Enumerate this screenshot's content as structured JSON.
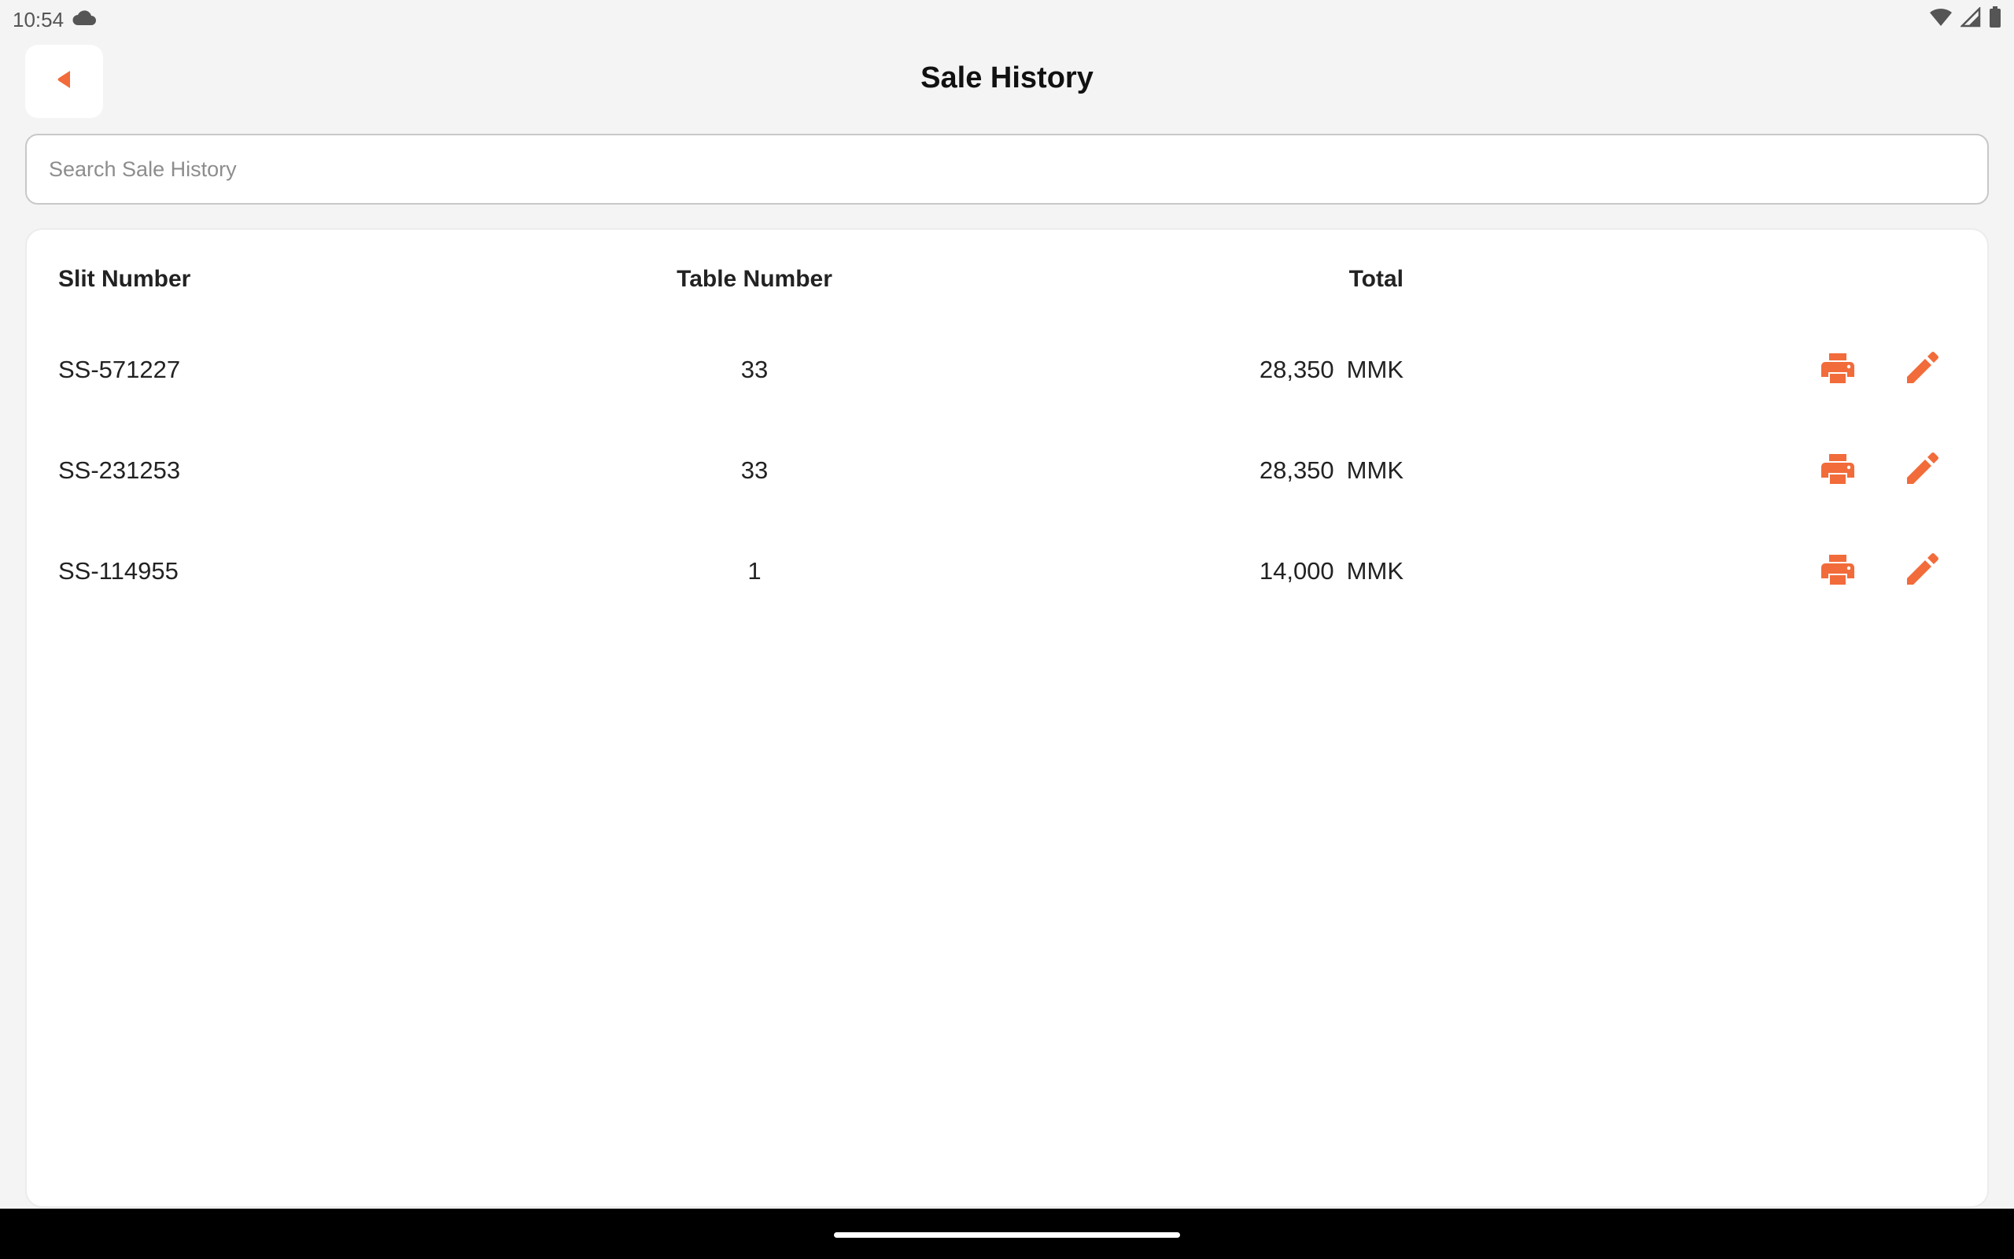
{
  "status_bar": {
    "time": "10:54",
    "icons": [
      "cloud-icon",
      "wifi-icon",
      "signal-icon",
      "battery-icon"
    ]
  },
  "header": {
    "title": "Sale History",
    "back_icon": "back-arrow-icon"
  },
  "search": {
    "placeholder": "Search Sale History",
    "value": ""
  },
  "table": {
    "columns": {
      "slit": "Slit Number",
      "table": "Table Number",
      "total": "Total"
    },
    "rows": [
      {
        "slit": "SS-571227",
        "table": "33",
        "amount": "28,350",
        "currency": "MMK"
      },
      {
        "slit": "SS-231253",
        "table": "33",
        "amount": "28,350",
        "currency": "MMK"
      },
      {
        "slit": "SS-114955",
        "table": "1",
        "amount": "14,000",
        "currency": "MMK"
      }
    ],
    "row_actions": [
      "printer-icon",
      "pencil-icon"
    ]
  },
  "colors": {
    "accent": "#f26b3a",
    "background": "#f4f4f4",
    "card": "#ffffff"
  }
}
